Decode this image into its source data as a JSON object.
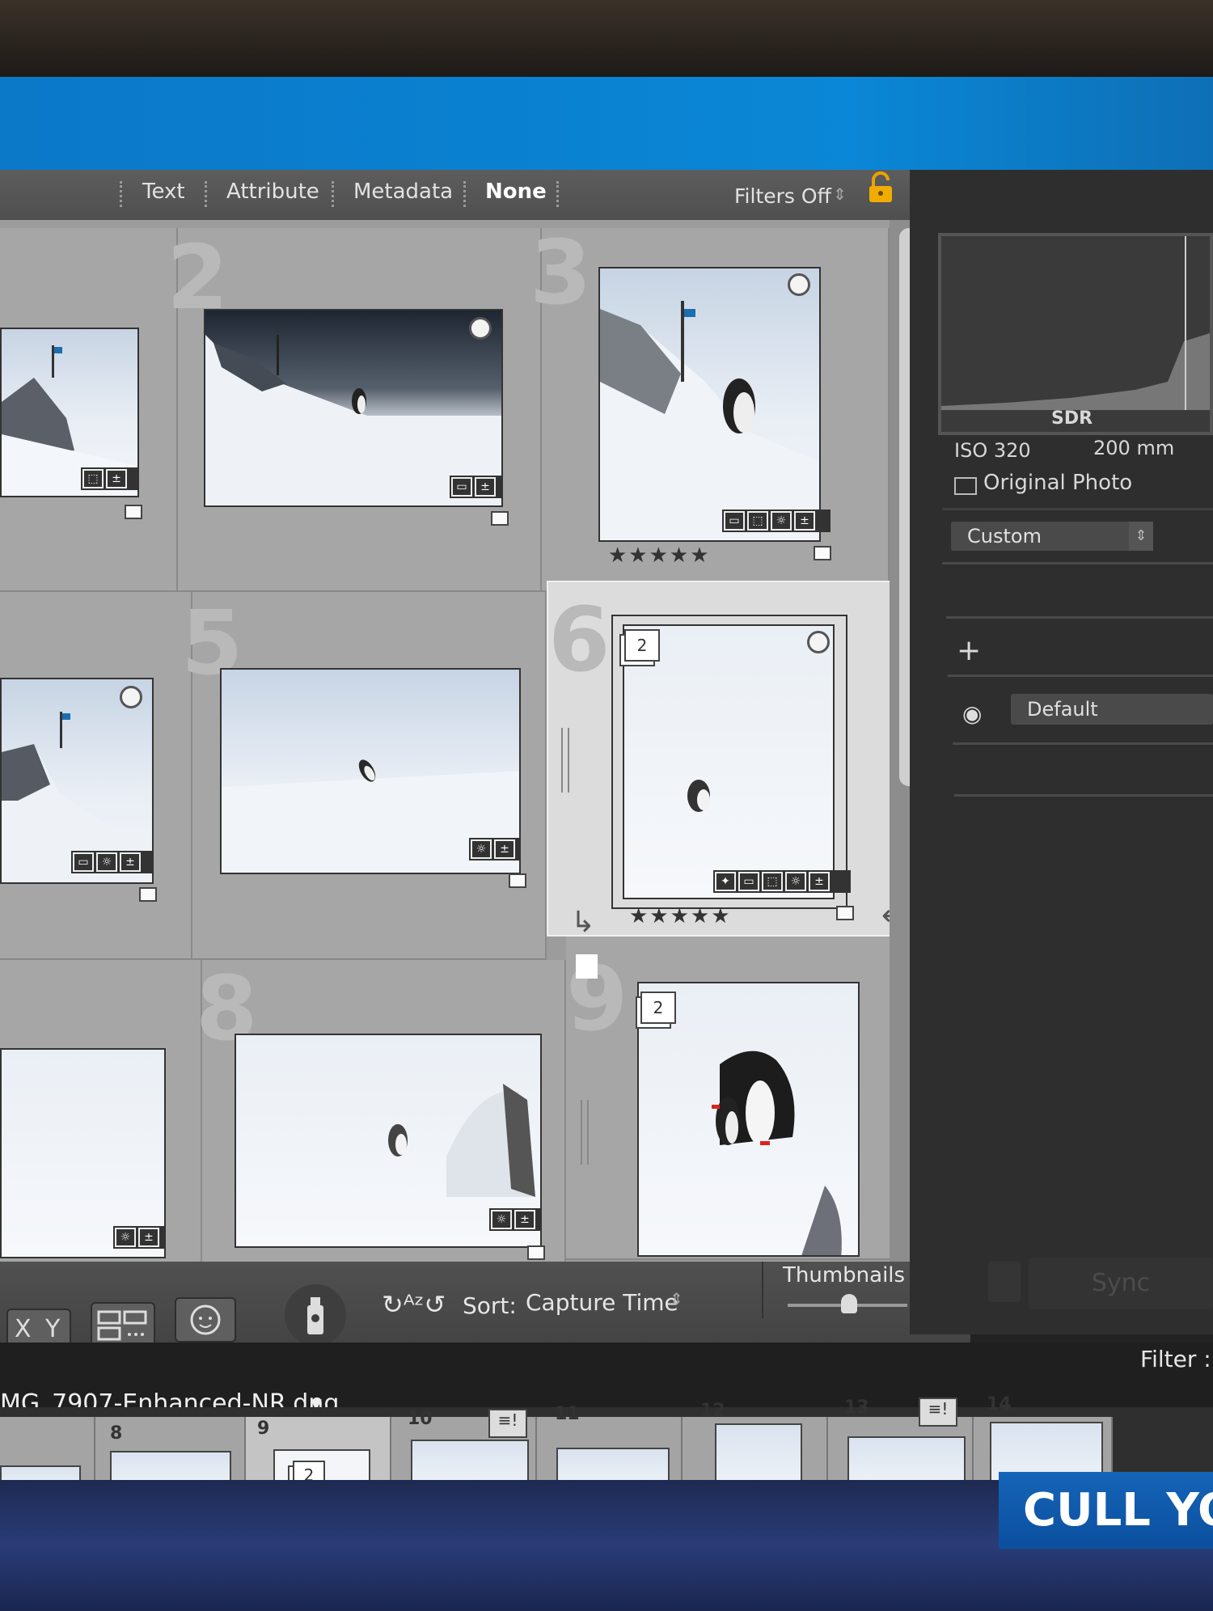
{
  "filter_bar": {
    "items": [
      "Text",
      "Attribute",
      "Metadata",
      "None"
    ],
    "status": "Filters Off",
    "status_arrows": "⇕"
  },
  "grid": {
    "cells": [
      {
        "index": "2"
      },
      {
        "index": "3",
        "stars": "★★★★★"
      },
      {
        "index": "5"
      },
      {
        "index": "6",
        "stars": "★★★★★",
        "stack_count": "2"
      },
      {
        "index": "8"
      },
      {
        "index": "9",
        "stack_count": "2"
      }
    ]
  },
  "toolbar": {
    "xy_label_x": "X",
    "xy_label_y": "Y",
    "sort_label": "Sort:",
    "sort_value": "Capture Time",
    "thumbnails_label": "Thumbnails"
  },
  "right_panel": {
    "histogram_mode": "SDR",
    "iso": "ISO 320",
    "focal_length": "200 mm",
    "original_photo": "Original Photo",
    "preset_select": "Custom",
    "add_icon": "+",
    "profile_select": "Default",
    "sync_button": "Sync",
    "filter_label": "Filter :"
  },
  "filmstrip": {
    "file_name": "MG_7907-Enhanced-NR.dng",
    "cells": [
      "8",
      "9",
      "10",
      "11",
      "12",
      "13",
      "14"
    ],
    "stack_count": "2"
  },
  "banner": {
    "text": "CULL YO"
  }
}
